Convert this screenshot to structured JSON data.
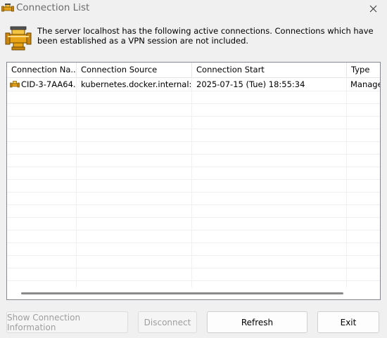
{
  "window": {
    "title": "Connection List",
    "title_icon": "connection-pipe-icon",
    "close_icon": "close-icon"
  },
  "message": {
    "icon": "connection-pipe-icon",
    "text": "The server localhost has the following active connections. Connections which have been established as a VPN session are not included."
  },
  "table": {
    "columns": [
      "Connection Na...",
      "Connection Source",
      "Connection Start",
      "Type"
    ],
    "rows": [
      {
        "icon": "connection-pipe-icon",
        "name": "CID-3-7AA64...",
        "source": "kubernetes.docker.internal: ...",
        "start": "2025-07-15 (Tue) 18:55:34",
        "type": "Manage"
      }
    ]
  },
  "buttons": {
    "show_info": "Show Connection Information",
    "disconnect": "Disconnect",
    "refresh": "Refresh",
    "exit": "Exit"
  }
}
